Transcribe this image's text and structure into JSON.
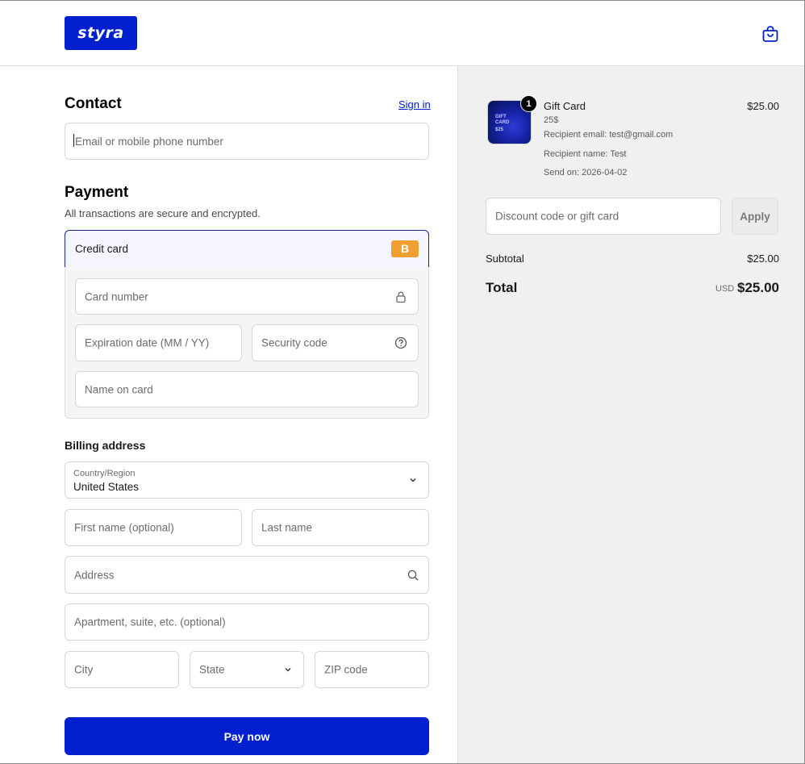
{
  "brand": {
    "logo_text": "styra"
  },
  "colors": {
    "accent": "#0020d0",
    "badge": "#f0a030"
  },
  "header": {
    "cart_icon": "shopping-bag-icon"
  },
  "contact": {
    "title": "Contact",
    "sign_in": "Sign in",
    "email_placeholder": "Email or mobile phone number"
  },
  "payment": {
    "title": "Payment",
    "subtitle": "All transactions are secure and encrypted.",
    "method_label": "Credit card",
    "method_badge": "B",
    "card_number_placeholder": "Card number",
    "expiry_placeholder": "Expiration date (MM / YY)",
    "security_placeholder": "Security code",
    "name_placeholder": "Name on card"
  },
  "billing": {
    "title": "Billing address",
    "country_label": "Country/Region",
    "country_value": "United States",
    "first_name_placeholder": "First name (optional)",
    "last_name_placeholder": "Last name",
    "address_placeholder": "Address",
    "apartment_placeholder": "Apartment, suite, etc. (optional)",
    "city_placeholder": "City",
    "state_placeholder": "State",
    "zip_placeholder": "ZIP code"
  },
  "pay_button": "Pay now",
  "order": {
    "item": {
      "name": "Gift Card",
      "quantity": "1",
      "variant": "25$",
      "recipient_email": "Recipient email: test@gmail.com",
      "recipient_name": "Recipient name: Test",
      "send_on": "Send on: 2026-04-02",
      "price": "$25.00",
      "thumb_text": "GIFT CARD",
      "thumb_amount": "$25"
    },
    "discount_placeholder": "Discount code or gift card",
    "apply_label": "Apply",
    "subtotal_label": "Subtotal",
    "subtotal_value": "$25.00",
    "total_label": "Total",
    "total_currency": "USD",
    "total_value": "$25.00"
  }
}
